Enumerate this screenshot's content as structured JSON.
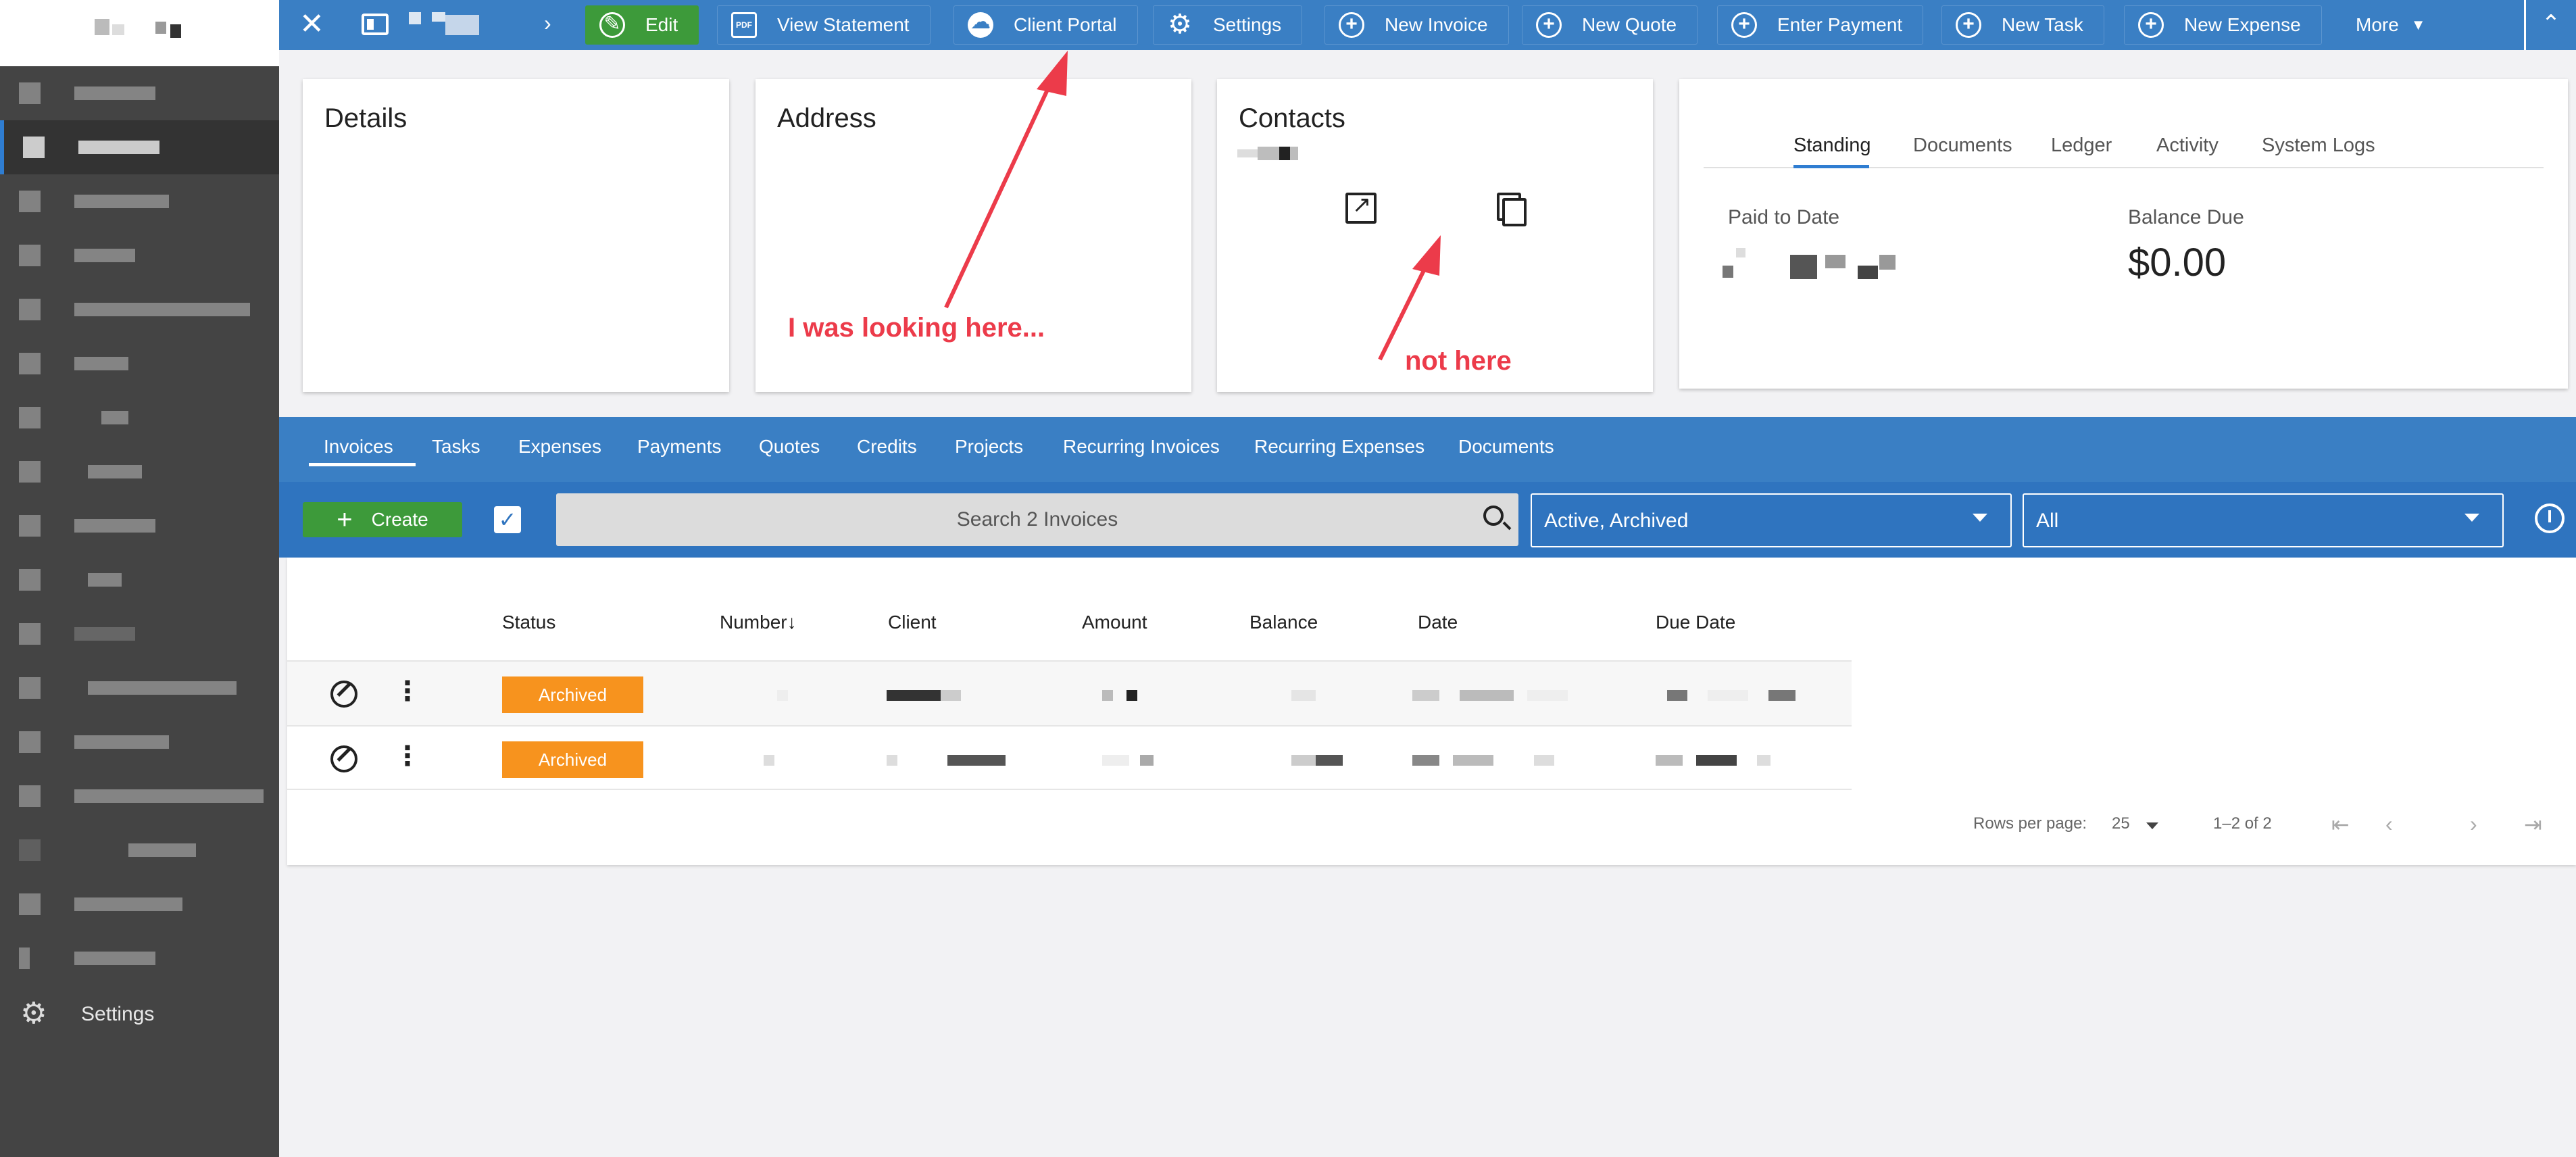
{
  "sidebar": {
    "settings_label": "Settings"
  },
  "topbar": {
    "buttons": [
      {
        "label": "Edit",
        "icon": "edit-icon"
      },
      {
        "label": "View Statement",
        "icon": "pdf-icon"
      },
      {
        "label": "Client Portal",
        "icon": "cloud-icon"
      },
      {
        "label": "Settings",
        "icon": "gear-icon"
      },
      {
        "label": "New Invoice",
        "icon": "add-circle-icon"
      },
      {
        "label": "New Quote",
        "icon": "add-circle-icon"
      },
      {
        "label": "Enter Payment",
        "icon": "add-circle-icon"
      },
      {
        "label": "New Task",
        "icon": "add-circle-icon"
      },
      {
        "label": "New Expense",
        "icon": "add-circle-icon"
      }
    ],
    "more_label": "More",
    "edit_color": "#3d9a3a",
    "bar_color": "#3a7fc4"
  },
  "cards": {
    "details_title": "Details",
    "address_title": "Address",
    "contacts_title": "Contacts",
    "annotation_here": "I was looking here...",
    "annotation_not_here": "not here",
    "annotation_color": "#ec3b4a"
  },
  "standing": {
    "tabs": [
      "Standing",
      "Documents",
      "Ledger",
      "Activity",
      "System Logs"
    ],
    "active_tab": "Standing",
    "paid_to_date_label": "Paid to Date",
    "balance_due_label": "Balance Due",
    "balance_due_value": "$0.00"
  },
  "entity_tabs": [
    "Invoices",
    "Tasks",
    "Expenses",
    "Payments",
    "Quotes",
    "Credits",
    "Projects",
    "Recurring Invoices",
    "Recurring Expenses",
    "Documents"
  ],
  "toolbar": {
    "create_label": "Create",
    "search_placeholder": "Search 2 Invoices",
    "status_filter": "Active, Archived",
    "custom_filter": "All"
  },
  "table": {
    "columns": [
      "Status",
      "Number",
      "Client",
      "Amount",
      "Balance",
      "Date",
      "Due Date"
    ],
    "sort_indicator": "↓",
    "rows": [
      {
        "status": "Archived"
      },
      {
        "status": "Archived"
      }
    ],
    "status_color": "#f7931e",
    "rows_per_page_label": "Rows per page:",
    "rows_per_page_value": "25",
    "range": "1–2 of 2"
  }
}
